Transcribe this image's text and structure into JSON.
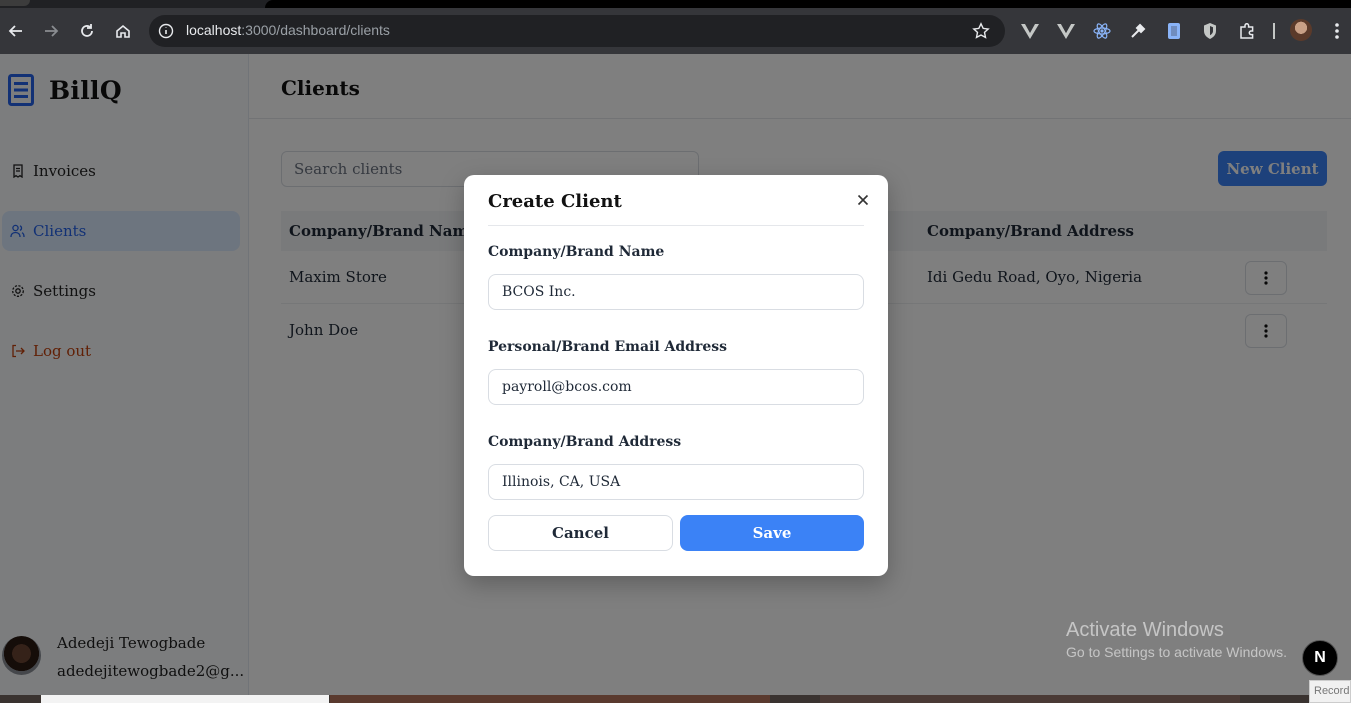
{
  "browser": {
    "url_host": "localhost",
    "url_path": ":3000/dashboard/clients",
    "icons": [
      "back-icon",
      "forward-icon",
      "reload-icon",
      "home-icon",
      "site-info-icon",
      "bookmark-star-icon",
      "menu-dots-icon"
    ]
  },
  "app": {
    "name": "BillQ",
    "accent_color": "#3b82f6"
  },
  "sidebar": {
    "items": [
      {
        "label": "Invoices",
        "icon": "receipt-icon",
        "active": false
      },
      {
        "label": "Clients",
        "icon": "users-icon",
        "active": true
      },
      {
        "label": "Settings",
        "icon": "gear-icon",
        "active": false
      },
      {
        "label": "Log out",
        "icon": "logout-icon",
        "active": false
      }
    ],
    "user": {
      "name": "Adedeji Tewogbade",
      "email": "adedejitewogbade2@g..."
    }
  },
  "main": {
    "title": "Clients",
    "search_placeholder": "Search clients",
    "new_client_label": "New Client",
    "table": {
      "headers": [
        "Company/Brand Name",
        "Company/Brand Address"
      ],
      "rows": [
        {
          "name": "Maxim Store",
          "address": "Idi Gedu Road, Oyo, Nigeria"
        },
        {
          "name": "John Doe",
          "address": ""
        }
      ]
    }
  },
  "modal": {
    "title": "Create Client",
    "fields": [
      {
        "label": "Company/Brand Name",
        "value": "BCOS Inc."
      },
      {
        "label": "Personal/Brand Email Address",
        "value": "payroll@bcos.com"
      },
      {
        "label": "Company/Brand Address",
        "value": "Illinois, CA, USA"
      }
    ],
    "cancel_label": "Cancel",
    "save_label": "Save"
  },
  "watermark": {
    "title": "Activate Windows",
    "subtitle": "Go to Settings to activate Windows."
  },
  "next_badge": "N",
  "recorder_label": "Record"
}
